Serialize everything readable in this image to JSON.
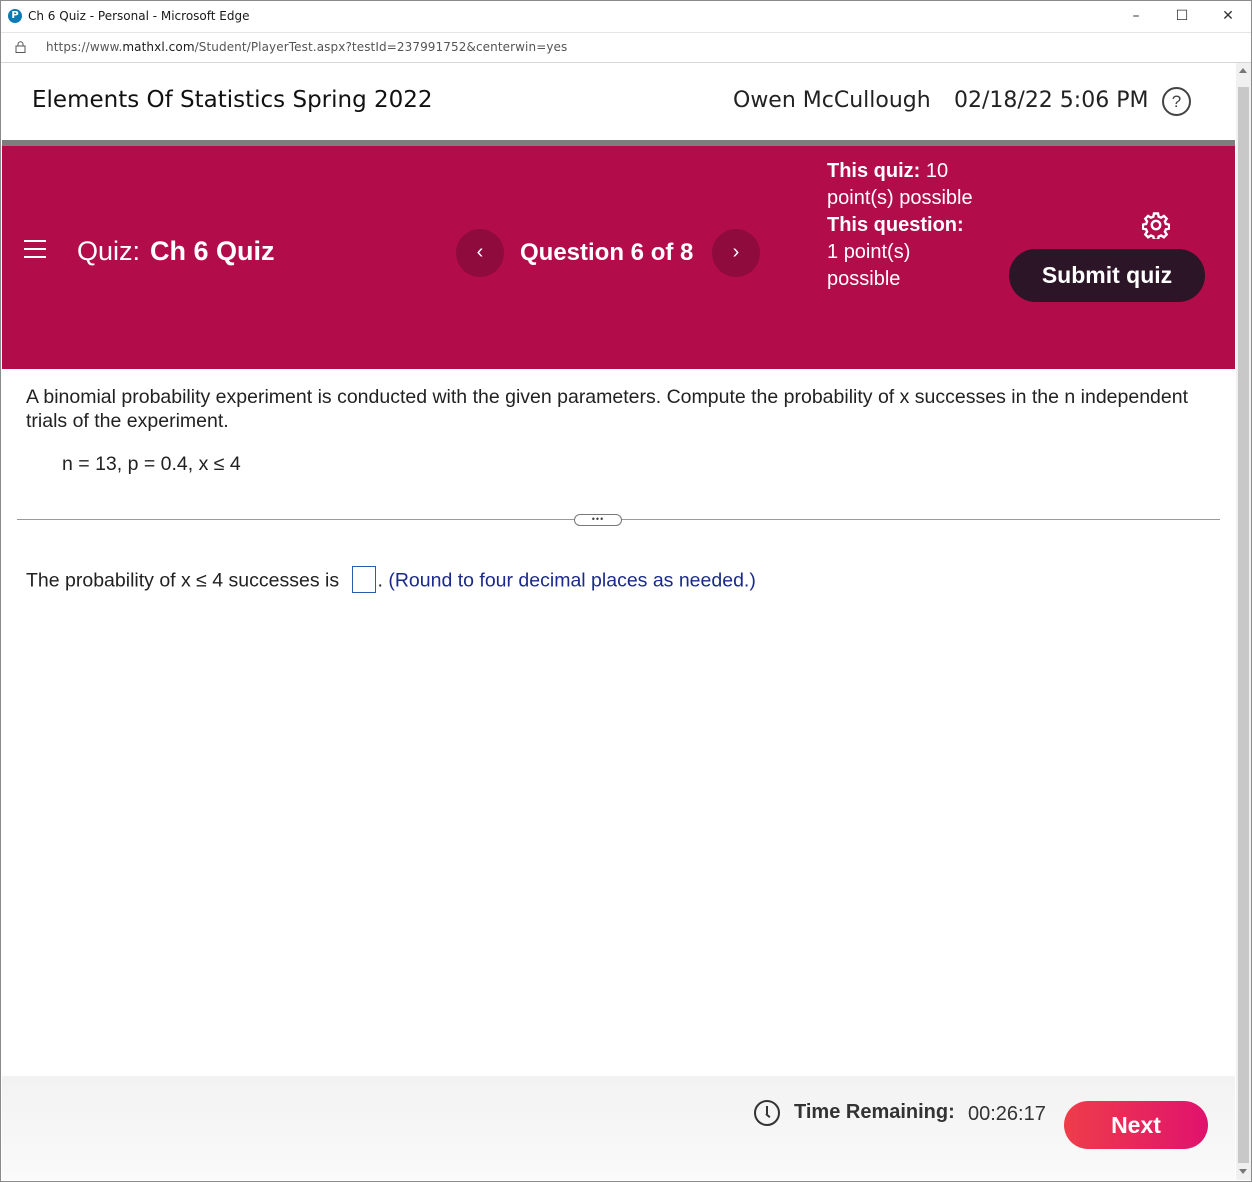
{
  "window": {
    "title": "Ch 6 Quiz - Personal - Microsoft Edge",
    "minimize": "–",
    "maximize": "☐",
    "close": "✕"
  },
  "address": {
    "url_prefix": "https://www.",
    "url_domain": "mathxl.com",
    "url_path": "/Student/PlayerTest.aspx?testId=237991752&centerwin=yes"
  },
  "header": {
    "course": "Elements Of Statistics Spring 2022",
    "user": "Owen McCullough",
    "datetime": "02/18/22 5:06 PM",
    "help": "?"
  },
  "banner": {
    "quiz_prefix": "Quiz:",
    "quiz_name": "Ch 6 Quiz",
    "prev": "‹",
    "next": "›",
    "question_counter": "Question 6 of 8",
    "quiz_points_label": "This quiz:",
    "quiz_points_value": "10",
    "quiz_points_suffix": "point(s) possible",
    "question_points_label": "This question:",
    "question_points_value": "1",
    "question_points_suffix": "point(s) possible",
    "submit": "Submit quiz"
  },
  "question": {
    "text": "A binomial probability experiment is conducted with the given parameters. Compute the probability of x successes in the n independent trials of the experiment.",
    "params": "n = 13, p = 0.4, x ≤ 4",
    "more": "•••",
    "answer_prefix": "The probability of x ≤ 4 successes is",
    "answer_value": "",
    "answer_suffix": ".",
    "hint": "(Round to four decimal places as needed.)"
  },
  "footer": {
    "time_label": "Time Remaining:",
    "time_value": "00:26:17",
    "next": "Next"
  }
}
